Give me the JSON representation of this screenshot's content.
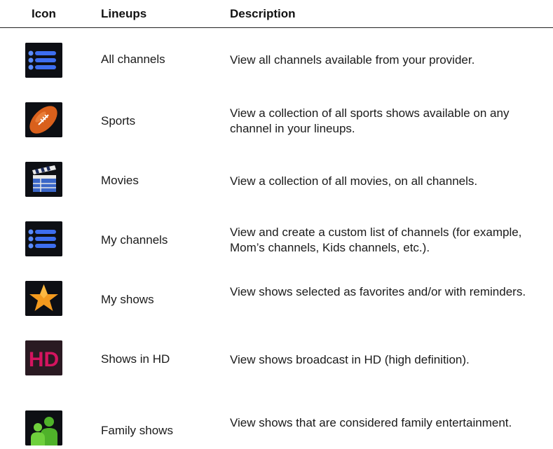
{
  "header": {
    "icon": "Icon",
    "lineups": "Lineups",
    "description": "Description"
  },
  "rows": [
    {
      "icon": "list-icon",
      "lineup": "All channels",
      "description": "View all channels available from your provider."
    },
    {
      "icon": "football-icon",
      "lineup": "Sports",
      "description": "View a collection of all sports shows available on any channel in your lineups."
    },
    {
      "icon": "clapperboard-icon",
      "lineup": "Movies",
      "description": "View a collection of all movies, on all channels."
    },
    {
      "icon": "list-icon",
      "lineup": "My channels",
      "description": "View and create a custom list of channels (for example, Mom’s channels, Kids channels, etc.)."
    },
    {
      "icon": "star-icon",
      "lineup": "My shows",
      "description": "View shows selected as favorites and/or with reminders."
    },
    {
      "icon": "hd-icon",
      "lineup": "Shows in HD",
      "description": "View shows broadcast in HD (high definition)."
    },
    {
      "icon": "family-icon",
      "lineup": "Family shows",
      "description": "View shows that are considered family entertainment."
    }
  ],
  "colors": {
    "list_blue": "#3d6ef0",
    "football_orange": "#d9601c",
    "star_orange": "#f39a1e",
    "hd_magenta": "#d4145f",
    "family_green": "#4fb22a"
  }
}
